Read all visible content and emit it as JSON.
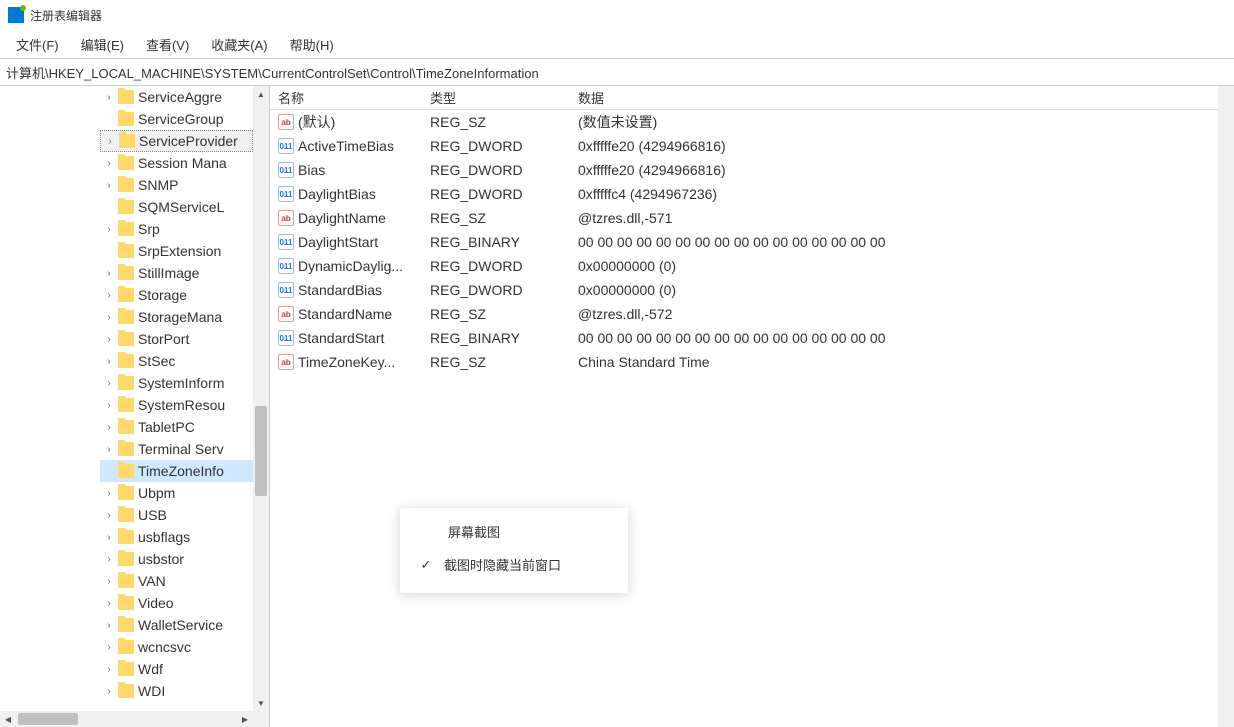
{
  "app": {
    "title": "注册表编辑器"
  },
  "menu": {
    "file": "文件(F)",
    "edit": "编辑(E)",
    "view": "查看(V)",
    "favorites": "收藏夹(A)",
    "help": "帮助(H)"
  },
  "address": "计算机\\HKEY_LOCAL_MACHINE\\SYSTEM\\CurrentControlSet\\Control\\TimeZoneInformation",
  "tree": [
    {
      "label": "ServiceAggre",
      "expandable": true,
      "selected": false
    },
    {
      "label": "ServiceGroup",
      "expandable": false,
      "selected": false
    },
    {
      "label": "ServiceProvider",
      "expandable": true,
      "selected": true
    },
    {
      "label": "Session Mana",
      "expandable": true,
      "selected": false
    },
    {
      "label": "SNMP",
      "expandable": true,
      "selected": false
    },
    {
      "label": "SQMServiceL",
      "expandable": false,
      "selected": false
    },
    {
      "label": "Srp",
      "expandable": true,
      "selected": false
    },
    {
      "label": "SrpExtension",
      "expandable": false,
      "selected": false
    },
    {
      "label": "StillImage",
      "expandable": true,
      "selected": false
    },
    {
      "label": "Storage",
      "expandable": true,
      "selected": false
    },
    {
      "label": "StorageMana",
      "expandable": true,
      "selected": false
    },
    {
      "label": "StorPort",
      "expandable": true,
      "selected": false
    },
    {
      "label": "StSec",
      "expandable": true,
      "selected": false
    },
    {
      "label": "SystemInform",
      "expandable": true,
      "selected": false
    },
    {
      "label": "SystemResou",
      "expandable": true,
      "selected": false
    },
    {
      "label": "TabletPC",
      "expandable": true,
      "selected": false
    },
    {
      "label": "Terminal Serv",
      "expandable": true,
      "selected": false
    },
    {
      "label": "TimeZoneInfo",
      "expandable": false,
      "selected": false,
      "highlighted": true
    },
    {
      "label": "Ubpm",
      "expandable": true,
      "selected": false
    },
    {
      "label": "USB",
      "expandable": true,
      "selected": false
    },
    {
      "label": "usbflags",
      "expandable": true,
      "selected": false
    },
    {
      "label": "usbstor",
      "expandable": true,
      "selected": false
    },
    {
      "label": "VAN",
      "expandable": true,
      "selected": false
    },
    {
      "label": "Video",
      "expandable": true,
      "selected": false
    },
    {
      "label": "WalletService",
      "expandable": true,
      "selected": false
    },
    {
      "label": "wcncsvc",
      "expandable": true,
      "selected": false
    },
    {
      "label": "Wdf",
      "expandable": true,
      "selected": false
    },
    {
      "label": "WDI",
      "expandable": true,
      "selected": false
    }
  ],
  "columns": {
    "name": "名称",
    "type": "类型",
    "data": "数据"
  },
  "rows": [
    {
      "icon": "sz",
      "name": "(默认)",
      "type": "REG_SZ",
      "data": "(数值未设置)"
    },
    {
      "icon": "bin",
      "name": "ActiveTimeBias",
      "type": "REG_DWORD",
      "data": "0xfffffe20 (4294966816)"
    },
    {
      "icon": "bin",
      "name": "Bias",
      "type": "REG_DWORD",
      "data": "0xfffffe20 (4294966816)"
    },
    {
      "icon": "bin",
      "name": "DaylightBias",
      "type": "REG_DWORD",
      "data": "0xfffffc4 (4294967236)"
    },
    {
      "icon": "sz",
      "name": "DaylightName",
      "type": "REG_SZ",
      "data": "@tzres.dll,-571"
    },
    {
      "icon": "bin",
      "name": "DaylightStart",
      "type": "REG_BINARY",
      "data": "00 00 00 00 00 00 00 00 00 00 00 00 00 00 00 00"
    },
    {
      "icon": "bin",
      "name": "DynamicDaylig...",
      "type": "REG_DWORD",
      "data": "0x00000000 (0)"
    },
    {
      "icon": "bin",
      "name": "StandardBias",
      "type": "REG_DWORD",
      "data": "0x00000000 (0)"
    },
    {
      "icon": "sz",
      "name": "StandardName",
      "type": "REG_SZ",
      "data": "@tzres.dll,-572"
    },
    {
      "icon": "bin",
      "name": "StandardStart",
      "type": "REG_BINARY",
      "data": "00 00 00 00 00 00 00 00 00 00 00 00 00 00 00 00"
    },
    {
      "icon": "sz",
      "name": "TimeZoneKey...",
      "type": "REG_SZ",
      "data": "China Standard Time"
    }
  ],
  "popup": {
    "title": "屏幕截图",
    "option": "截图时隐藏当前窗口"
  }
}
